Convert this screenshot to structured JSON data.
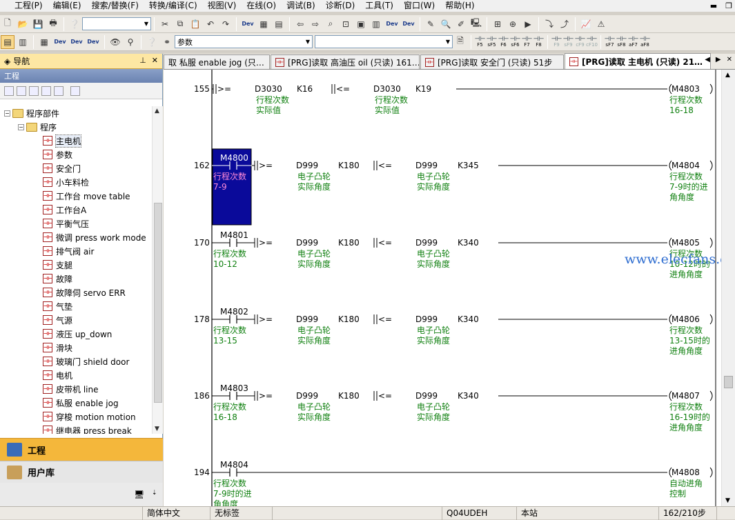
{
  "menus": [
    "工程(P)",
    "编辑(E)",
    "搜索/替换(F)",
    "转换/编译(C)",
    "视图(V)",
    "在线(O)",
    "调试(B)",
    "诊断(D)",
    "工具(T)",
    "窗口(W)",
    "帮助(H)"
  ],
  "toolbar": {
    "combo1": "",
    "combo2": "参数",
    "fkeys": [
      "F5",
      "sF5",
      "F6",
      "sF6",
      "F7",
      "F8",
      "F9",
      "sF9",
      "cF9",
      "cF10",
      "sF7",
      "sF8",
      "aF7",
      "aF8"
    ]
  },
  "nav": {
    "title": "导航",
    "section": "工程",
    "root": "程序部件",
    "folder": "程序",
    "items": [
      "主电机",
      "参数",
      "安全门",
      "小车料检",
      "工作台 move table",
      "工作台A",
      "平衡气压",
      "微调 press work mode",
      "排气阀 air",
      "支腿",
      "故障",
      "故障伺 servo ERR",
      "气垫",
      "气源",
      "液压 up_down",
      "滑块",
      "玻璃门 shield door",
      "电机",
      "皮带机 line",
      "私服 enable jog",
      "穿梭 motion motion",
      "继电器 press break"
    ],
    "selected_index": 0,
    "project_label": "工程",
    "library_label": "用户库"
  },
  "tabs": [
    {
      "label": "取 私服 enable jog (只…"
    },
    {
      "label": "[PRG]读取 高油压 oil (只读) 161…"
    },
    {
      "label": "[PRG]读取 安全门 (只读) 51步"
    },
    {
      "label": "[PRG]读取 主电机 (只读) 21…",
      "active": true
    }
  ],
  "rungs": [
    {
      "step": "155",
      "contact": null,
      "contact_cmt": [],
      "cmp1": {
        "op": ">=",
        "a": "D3030",
        "a_cmt": [
          "行程次数",
          "实际值"
        ],
        "b": "K16"
      },
      "cmp2": {
        "op": "<=",
        "a": "D3030",
        "a_cmt": [
          "行程次数",
          "实际值"
        ],
        "b": "K19"
      },
      "coil": "M4803",
      "coil_cmt": [
        "行程次数",
        "16-18"
      ]
    },
    {
      "step": "162",
      "contact": "M4800",
      "contact_cmt": [
        "行程次数",
        "7-9"
      ],
      "selected": true,
      "cmp1": {
        "op": ">=",
        "a": "D999",
        "a_cmt": [
          "电子凸轮",
          "实际角度"
        ],
        "b": "K180"
      },
      "cmp2": {
        "op": "<=",
        "a": "D999",
        "a_cmt": [
          "电子凸轮",
          "实际角度"
        ],
        "b": "K345"
      },
      "coil": "M4804",
      "coil_cmt": [
        "行程次数",
        "7-9时的进",
        "角角度"
      ]
    },
    {
      "step": "170",
      "contact": "M4801",
      "contact_cmt": [
        "行程次数",
        "10-12"
      ],
      "cmp1": {
        "op": ">=",
        "a": "D999",
        "a_cmt": [
          "电子凸轮",
          "实际角度"
        ],
        "b": "K180"
      },
      "cmp2": {
        "op": "<=",
        "a": "D999",
        "a_cmt": [
          "电子凸轮",
          "实际角度"
        ],
        "b": "K340"
      },
      "coil": "M4805",
      "coil_cmt": [
        "行程次数",
        "10-12时的",
        "进角角度"
      ]
    },
    {
      "step": "178",
      "contact": "M4802",
      "contact_cmt": [
        "行程次数",
        "13-15"
      ],
      "cmp1": {
        "op": ">=",
        "a": "D999",
        "a_cmt": [
          "电子凸轮",
          "实际角度"
        ],
        "b": "K180"
      },
      "cmp2": {
        "op": "<=",
        "a": "D999",
        "a_cmt": [
          "电子凸轮",
          "实际角度"
        ],
        "b": "K340"
      },
      "coil": "M4806",
      "coil_cmt": [
        "行程次数",
        "13-15时的",
        "进角角度"
      ]
    },
    {
      "step": "186",
      "contact": "M4803",
      "contact_cmt": [
        "行程次数",
        "16-18"
      ],
      "cmp1": {
        "op": ">=",
        "a": "D999",
        "a_cmt": [
          "电子凸轮",
          "实际角度"
        ],
        "b": "K180"
      },
      "cmp2": {
        "op": "<=",
        "a": "D999",
        "a_cmt": [
          "电子凸轮",
          "实际角度"
        ],
        "b": "K340"
      },
      "coil": "M4807",
      "coil_cmt": [
        "行程次数",
        "16-19时的",
        "进角角度"
      ]
    },
    {
      "step": "194",
      "contact": "M4804",
      "contact_cmt": [
        "行程次数",
        "7-9时的进",
        "角角度"
      ],
      "cmp1": null,
      "cmp2": null,
      "coil": "M4808",
      "coil_cmt": [
        "自动进角",
        "控制"
      ]
    }
  ],
  "watermark": "www.elecfans.com",
  "status": {
    "lang": "简体中文",
    "label": "无标签",
    "cpu": "Q04UDEH",
    "station": "本站",
    "steps": "162/210步"
  },
  "colors": {
    "selection_bg": "#0a0a9a",
    "comment_green": "#108010",
    "nav_active": "#f4b73b",
    "nav_title": "#fde7a3"
  }
}
